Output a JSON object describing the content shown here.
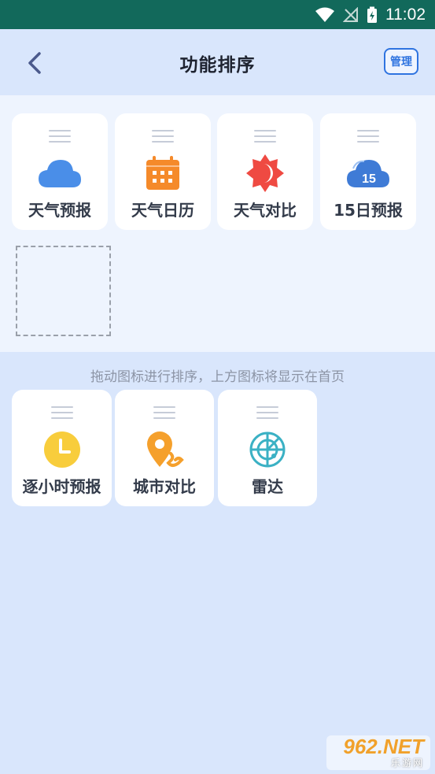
{
  "status_bar": {
    "time": "11:02"
  },
  "header": {
    "title": "功能排序",
    "manage_label": "管理"
  },
  "top_cards": [
    {
      "label": "天气预报",
      "icon": "cloud-icon",
      "color": "#4a8ee8"
    },
    {
      "label": "天气日历",
      "icon": "calendar-icon",
      "color": "#f58a2a"
    },
    {
      "label": "天气对比",
      "icon": "sun-moon-icon",
      "color": "#ef4a42"
    },
    {
      "label": "15日预报",
      "icon": "cloud-15-icon",
      "color": "#3f7bd6"
    }
  ],
  "hint": "拖动图标进行排序，上方图标将显示在首页",
  "bottom_cards": [
    {
      "label": "逐小时预报",
      "icon": "clock-icon",
      "color": "#f8cd3c"
    },
    {
      "label": "城市对比",
      "icon": "location-icon",
      "color": "#f5a02c"
    },
    {
      "label": "雷达",
      "icon": "radar-icon",
      "color": "#3bb1c4"
    }
  ],
  "watermark": {
    "brand": "962.NET",
    "sub": "乐游网"
  }
}
